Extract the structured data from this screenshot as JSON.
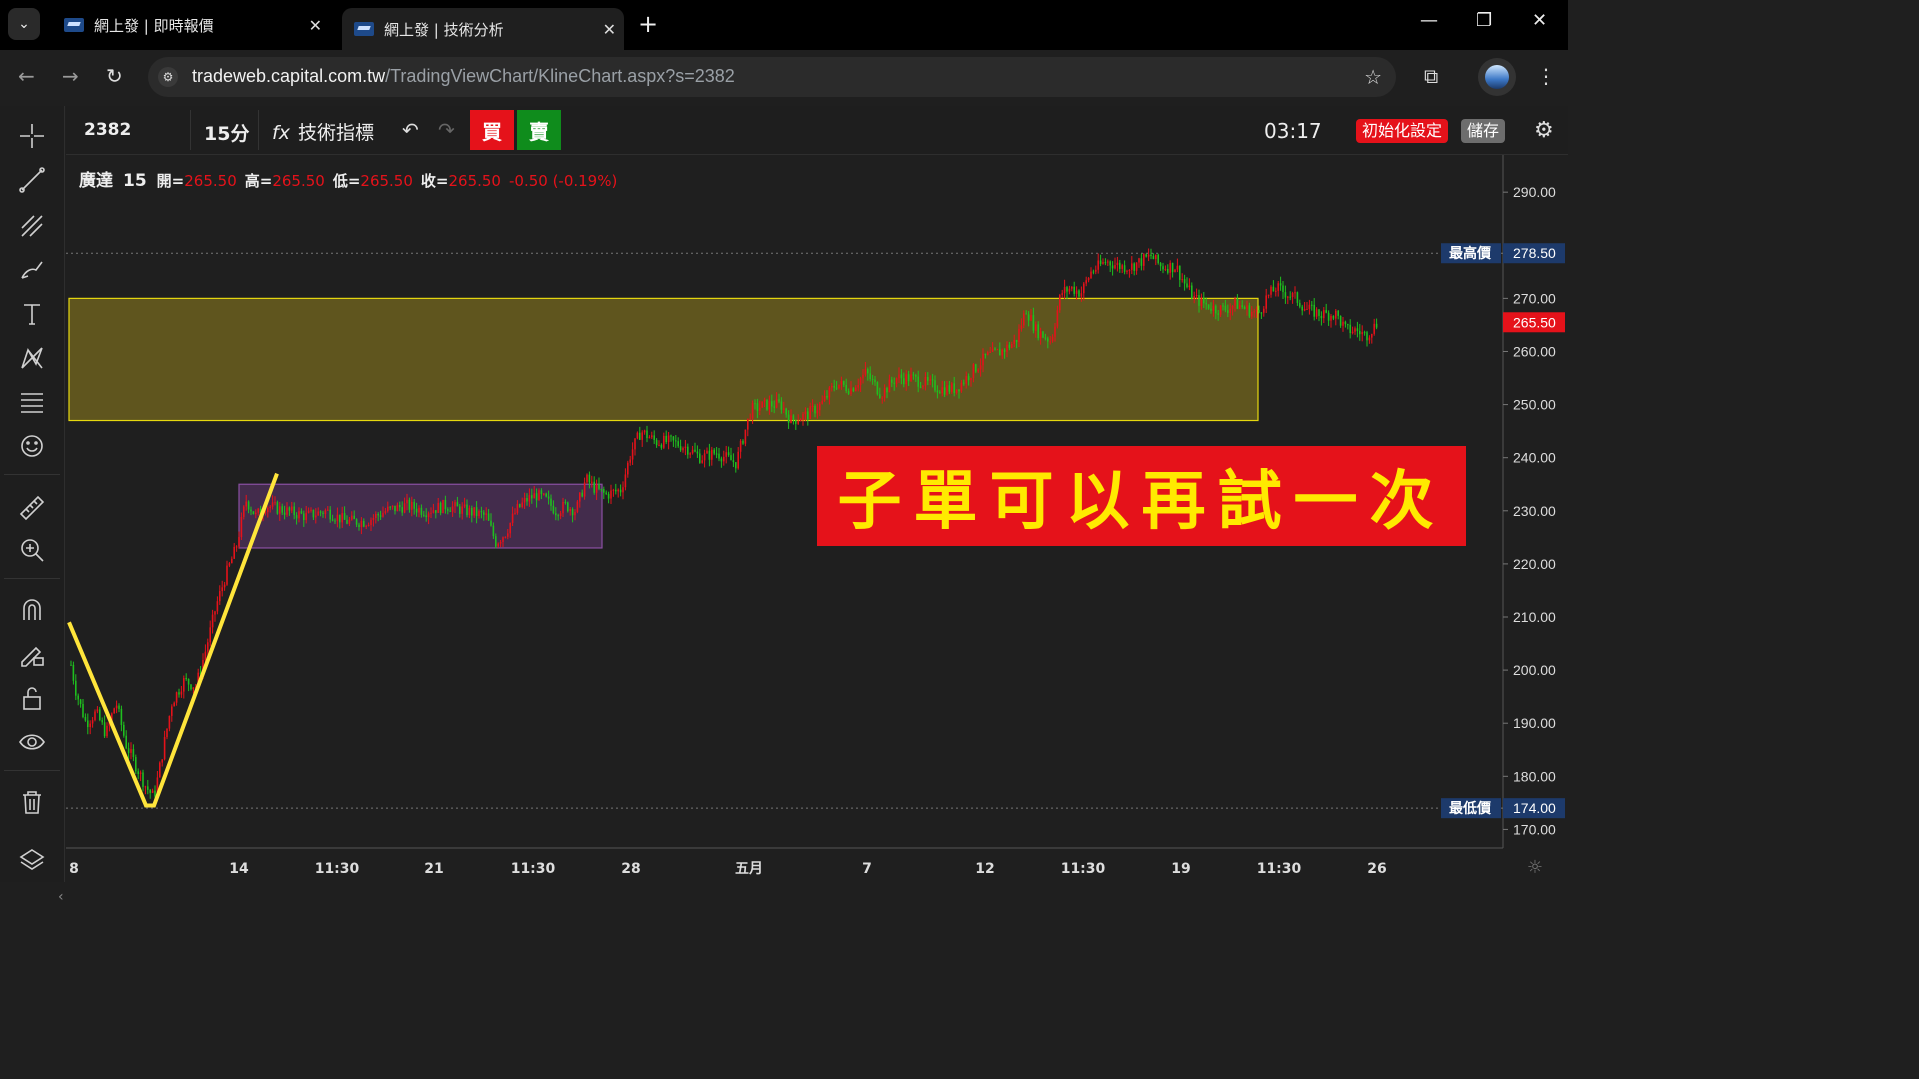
{
  "browser": {
    "tabs": [
      {
        "title": "網上發 | 即時報價",
        "active": false
      },
      {
        "title": "網上發 | 技術分析",
        "active": true
      }
    ],
    "url_host": "tradeweb.capital.com.tw",
    "url_path": "/TradingViewChart/KlineChart.aspx?s=2382",
    "icons": [
      "tab-search-icon",
      "close-icon",
      "new-tab-icon",
      "minimize-icon",
      "restore-icon",
      "window-close-icon",
      "back-icon",
      "forward-icon",
      "reload-icon",
      "site-info-icon",
      "bookmark-star-icon",
      "extensions-icon",
      "profile-avatar",
      "menu-icon"
    ]
  },
  "toolbar": {
    "symbol": "2382",
    "interval": "15分",
    "indicators_label": "技術指標",
    "buy_label": "買",
    "sell_label": "賣",
    "clock": "03:17",
    "reset_label": "初始化設定",
    "save_label": "儲存"
  },
  "left_tools": [
    "crosshair-icon",
    "trend-line-icon",
    "fib-tool-icon",
    "brush-icon",
    "text-icon",
    "pattern-icon",
    "prediction-icon",
    "emoji-icon",
    "ruler-icon",
    "zoom-in-icon",
    "magnet-icon",
    "lock-draw-icon",
    "unlock-icon",
    "eye-icon",
    "trash-icon",
    "layers-icon"
  ],
  "legend": {
    "name": "廣達",
    "interval": "15",
    "open_label": "開=",
    "open": "265.50",
    "high_label": "高=",
    "high": "265.50",
    "low_label": "低=",
    "low": "265.50",
    "close_label": "收=",
    "close": "265.50",
    "change": "-0.50 (-0.19%)"
  },
  "banner_text": "子單可以再試一次",
  "colors": {
    "up": "#e5121a",
    "down": "#1fbf1f",
    "buy_bg": "#e5121a",
    "sell_bg": "#0f8c1c",
    "yellow_zone": "#6b5f1e",
    "purple_zone": "#4a2f55",
    "v_line": "#ffe53b",
    "axis_label_bg": "#1d3a6b",
    "banner_bg": "#e5121a",
    "banner_text": "#ffea00"
  },
  "chart_data": {
    "type": "candlestick",
    "y_ticks": [
      170,
      180,
      190,
      200,
      210,
      220,
      230,
      240,
      250,
      260,
      270,
      290
    ],
    "y_tick_labels": [
      "170.00",
      "180.00",
      "190.00",
      "200.00",
      "210.00",
      "220.00",
      "230.00",
      "240.00",
      "250.00",
      "260.00",
      "270.00",
      "290.00"
    ],
    "ylim": [
      166.5,
      297
    ],
    "x_ticks": [
      "8",
      "14",
      "11:30",
      "21",
      "11:30",
      "28",
      "五月",
      "7",
      "12",
      "11:30",
      "19",
      "11:30",
      "26"
    ],
    "x_tick_positions": [
      8,
      173,
      271,
      368,
      467,
      565,
      683,
      801,
      919,
      1017,
      1115,
      1213,
      1311
    ],
    "highest": {
      "label": "最高價",
      "value": "278.50",
      "y": 278.5
    },
    "lowest": {
      "label": "最低價",
      "value": "174.00",
      "y": 174
    },
    "last": {
      "value": "265.50",
      "y": 265.5
    },
    "zones": [
      {
        "name": "resistance",
        "x0": 3,
        "x1": 1192,
        "y0": 270,
        "y1": 247
      },
      {
        "name": "consolidation",
        "x0": 173,
        "x1": 536,
        "y0": 235,
        "y1": 223
      }
    ],
    "v_line": [
      [
        3,
        209
      ],
      [
        80,
        174.5
      ],
      [
        88,
        174.5
      ],
      [
        211,
        237
      ]
    ],
    "price_path": [
      [
        5,
        201
      ],
      [
        10,
        196
      ],
      [
        20,
        190
      ],
      [
        30,
        192
      ],
      [
        40,
        188
      ],
      [
        50,
        194
      ],
      [
        60,
        186
      ],
      [
        70,
        182
      ],
      [
        80,
        178
      ],
      [
        88,
        176
      ],
      [
        96,
        184
      ],
      [
        106,
        194
      ],
      [
        118,
        198
      ],
      [
        130,
        197
      ],
      [
        140,
        204
      ],
      [
        150,
        212
      ],
      [
        160,
        218
      ],
      [
        170,
        223
      ],
      [
        180,
        232
      ],
      [
        190,
        229
      ],
      [
        200,
        231
      ],
      [
        220,
        230
      ],
      [
        240,
        229
      ],
      [
        260,
        230
      ],
      [
        280,
        228
      ],
      [
        300,
        228
      ],
      [
        320,
        230
      ],
      [
        340,
        231
      ],
      [
        360,
        230
      ],
      [
        380,
        231
      ],
      [
        400,
        230
      ],
      [
        420,
        229
      ],
      [
        430,
        224
      ],
      [
        440,
        226
      ],
      [
        450,
        230
      ],
      [
        460,
        232
      ],
      [
        470,
        233
      ],
      [
        480,
        232
      ],
      [
        490,
        230
      ],
      [
        500,
        231
      ],
      [
        510,
        230
      ],
      [
        520,
        236
      ],
      [
        530,
        234
      ],
      [
        540,
        233
      ],
      [
        555,
        234
      ],
      [
        565,
        241
      ],
      [
        575,
        245
      ],
      [
        590,
        243
      ],
      [
        605,
        243
      ],
      [
        620,
        242
      ],
      [
        635,
        240
      ],
      [
        650,
        241
      ],
      [
        660,
        240
      ],
      [
        670,
        239
      ],
      [
        685,
        249
      ],
      [
        700,
        250
      ],
      [
        715,
        250
      ],
      [
        725,
        247
      ],
      [
        740,
        248
      ],
      [
        755,
        250
      ],
      [
        770,
        254
      ],
      [
        785,
        253
      ],
      [
        800,
        256
      ],
      [
        815,
        252
      ],
      [
        830,
        255
      ],
      [
        845,
        255
      ],
      [
        860,
        254
      ],
      [
        875,
        253
      ],
      [
        890,
        253
      ],
      [
        905,
        256
      ],
      [
        920,
        259
      ],
      [
        935,
        260
      ],
      [
        950,
        262
      ],
      [
        960,
        268
      ],
      [
        970,
        264
      ],
      [
        985,
        262
      ],
      [
        995,
        271
      ],
      [
        1005,
        272
      ],
      [
        1015,
        271
      ],
      [
        1025,
        275
      ],
      [
        1040,
        277
      ],
      [
        1055,
        276
      ],
      [
        1065,
        276
      ],
      [
        1075,
        277
      ],
      [
        1085,
        278
      ],
      [
        1095,
        276
      ],
      [
        1110,
        276
      ],
      [
        1118,
        273
      ],
      [
        1128,
        270
      ],
      [
        1138,
        269
      ],
      [
        1150,
        268
      ],
      [
        1160,
        268
      ],
      [
        1170,
        269
      ],
      [
        1180,
        268
      ],
      [
        1192,
        267
      ],
      [
        1200,
        270
      ],
      [
        1210,
        272
      ],
      [
        1220,
        271
      ],
      [
        1230,
        270
      ],
      [
        1240,
        268
      ],
      [
        1255,
        267
      ],
      [
        1270,
        267
      ],
      [
        1280,
        264
      ],
      [
        1290,
        264
      ],
      [
        1300,
        263
      ],
      [
        1312,
        265.5
      ]
    ]
  }
}
